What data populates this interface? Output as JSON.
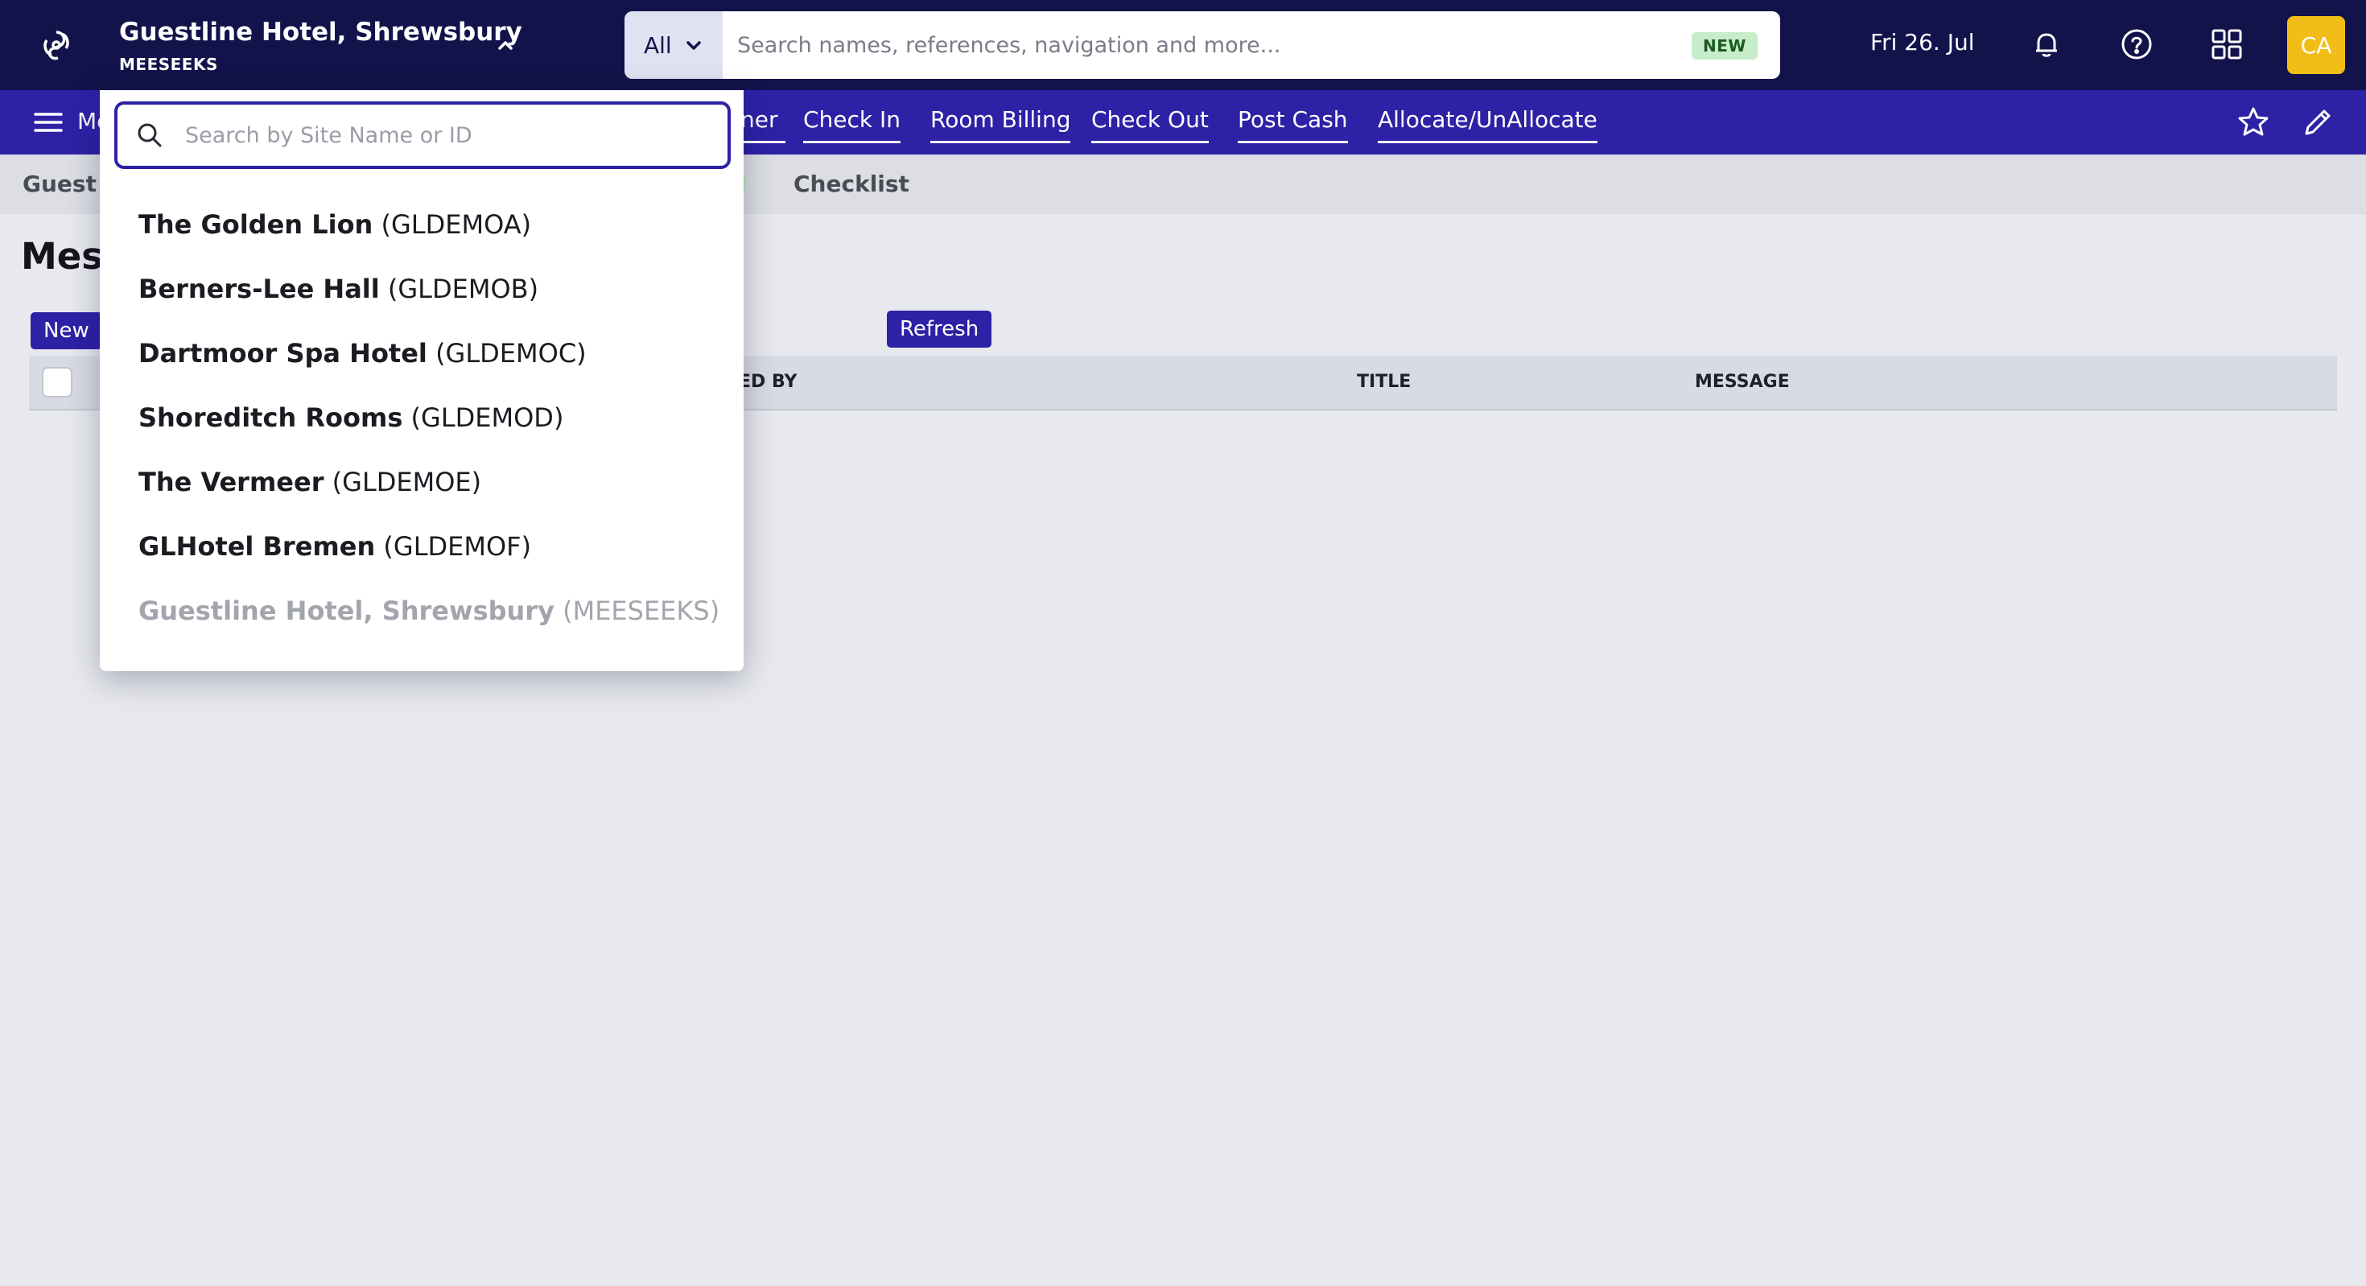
{
  "header": {
    "site_name": "Guestline Hotel, Shrewsbury",
    "site_code": "MEESEEKS",
    "search_scope": "All",
    "search_placeholder": "Search names, references, navigation and more...",
    "search_badge": "NEW",
    "date": "Fri 26. Jul",
    "avatar_initials": "CA",
    "icons": [
      "logo-icon",
      "bell-icon",
      "help-icon",
      "apps-grid-icon"
    ]
  },
  "nav": {
    "menu_label": "Me",
    "links": [
      "ner",
      "Check In",
      "Room Billing",
      "Check Out",
      "Post Cash",
      "Allocate/UnAllocate"
    ]
  },
  "crumbs": {
    "first": "Guest I",
    "checklist": "Checklist"
  },
  "page": {
    "title": "Mess",
    "new_button": "New",
    "refresh_button": "Refresh",
    "columns": [
      "ED BY",
      "TITLE",
      "MESSAGE"
    ]
  },
  "site_dropdown": {
    "placeholder": "Search by Site Name or ID",
    "sites": [
      {
        "name": "The Golden Lion",
        "code": "(GLDEMOA)"
      },
      {
        "name": "Berners-Lee Hall",
        "code": "(GLDEMOB)"
      },
      {
        "name": "Dartmoor Spa Hotel",
        "code": "(GLDEMOC)"
      },
      {
        "name": "Shoreditch Rooms",
        "code": "(GLDEMOD)"
      },
      {
        "name": "The Vermeer",
        "code": "(GLDEMOE)"
      },
      {
        "name": "GLHotel Bremen",
        "code": "(GLDEMOF)"
      },
      {
        "name": "Guestline Hotel, Shrewsbury",
        "code": "(MEESEEKS)"
      }
    ]
  },
  "colors": {
    "topbar": "#13134b",
    "navbar": "#2d21a6",
    "accent": "#2d21a6",
    "avatar": "#f3bd17",
    "badge_bg": "#c7ecc9"
  }
}
